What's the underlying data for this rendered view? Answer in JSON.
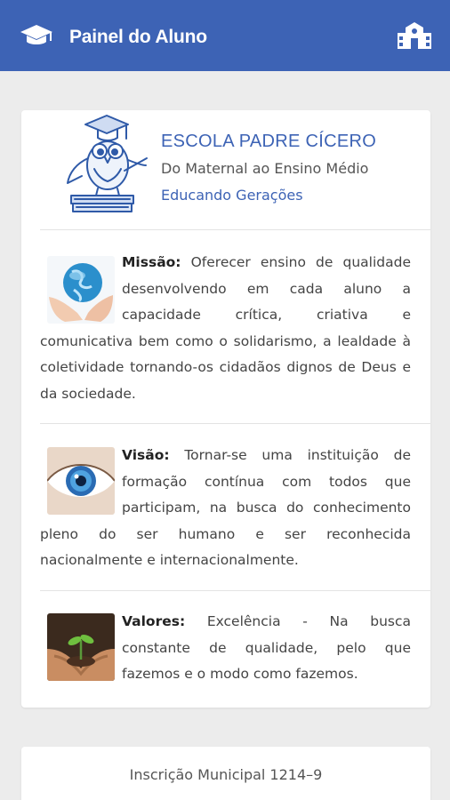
{
  "appbar": {
    "title": "Painel do Aluno",
    "left_icon": "graduation-cap-icon",
    "right_icon": "school-building-icon",
    "color": "#3d63b5"
  },
  "school": {
    "name": "ESCOLA PADRE CÍCERO",
    "subtitle": "Do Maternal ao Ensino Médio",
    "slogan": "Educando Gerações"
  },
  "sections": {
    "missao": {
      "label": "Missão:",
      "text": " Oferecer ensino de qualidade desenvolvendo em cada aluno a capacidade crítica, criativa e comunicativa bem como o solidarismo, a lealdade à coletividade tornando-os cidadãos dignos de Deus e da sociedade."
    },
    "visao": {
      "label": "Visão:",
      "text": " Tornar-se uma instituição de formação contínua com todos que participam, na busca do conhecimento pleno do ser humano e ser reconhecida nacionalmente e internacionalmente."
    },
    "valores": {
      "label": "Valores:",
      "text": " Excelência - Na busca constante de qualidade, pelo que fazemos e o modo como fazemos."
    }
  },
  "footer": {
    "inscricao": "Inscrição Municipal 1214–9"
  }
}
